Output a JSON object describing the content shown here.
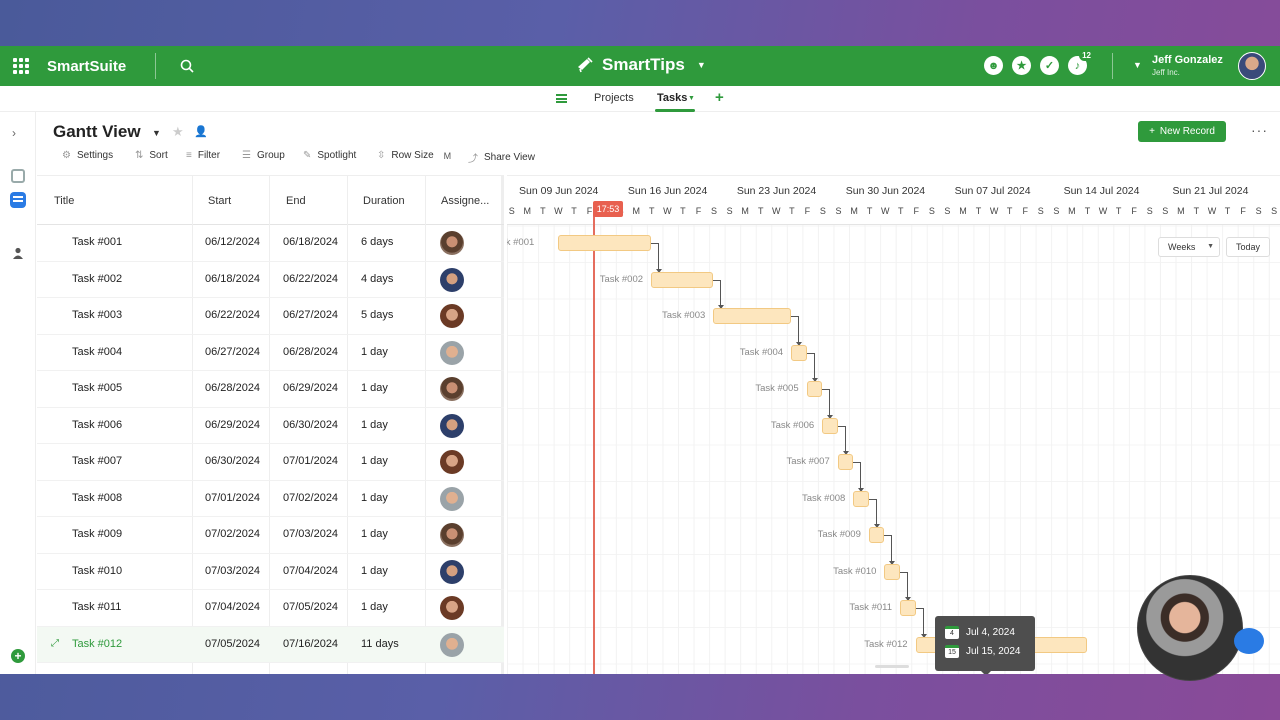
{
  "topbar": {
    "brand": "SmartSuite",
    "workspace": "SmartTips",
    "notification_count": "12",
    "user_name": "Jeff Gonzalez",
    "user_org": "Jeff Inc."
  },
  "nav": {
    "projects": "Projects",
    "tasks": "Tasks"
  },
  "view": {
    "title": "Gantt View",
    "new_record": "New Record",
    "toolbar": {
      "settings": "Settings",
      "sort": "Sort",
      "filter": "Filter",
      "group": "Group",
      "spotlight": "Spotlight",
      "row_size": "Row Size",
      "row_size_value": "M",
      "share_view": "Share View"
    }
  },
  "table": {
    "headers": {
      "title": "Title",
      "start": "Start",
      "end": "End",
      "duration": "Duration",
      "assignee": "Assigne..."
    },
    "rows": [
      {
        "title": "Task #001",
        "start": "06/12/2024",
        "end": "06/18/2024",
        "duration": "6 days"
      },
      {
        "title": "Task #002",
        "start": "06/18/2024",
        "end": "06/22/2024",
        "duration": "4 days"
      },
      {
        "title": "Task #003",
        "start": "06/22/2024",
        "end": "06/27/2024",
        "duration": "5 days"
      },
      {
        "title": "Task #004",
        "start": "06/27/2024",
        "end": "06/28/2024",
        "duration": "1 day"
      },
      {
        "title": "Task #005",
        "start": "06/28/2024",
        "end": "06/29/2024",
        "duration": "1 day"
      },
      {
        "title": "Task #006",
        "start": "06/29/2024",
        "end": "06/30/2024",
        "duration": "1 day"
      },
      {
        "title": "Task #007",
        "start": "06/30/2024",
        "end": "07/01/2024",
        "duration": "1 day"
      },
      {
        "title": "Task #008",
        "start": "07/01/2024",
        "end": "07/02/2024",
        "duration": "1 day"
      },
      {
        "title": "Task #009",
        "start": "07/02/2024",
        "end": "07/03/2024",
        "duration": "1 day"
      },
      {
        "title": "Task #010",
        "start": "07/03/2024",
        "end": "07/04/2024",
        "duration": "1 day"
      },
      {
        "title": "Task #011",
        "start": "07/04/2024",
        "end": "07/05/2024",
        "duration": "1 day"
      },
      {
        "title": "Task #012",
        "start": "07/05/2024",
        "end": "07/16/2024",
        "duration": "11 days"
      }
    ]
  },
  "gantt": {
    "weeks": [
      "Sun 09 Jun 2024",
      "Sun 16 Jun 2024",
      "Sun 23 Jun 2024",
      "Sun 30 Jun 2024",
      "Sun 07 Jul 2024",
      "Sun 14 Jul 2024",
      "Sun 21 Jul 2024"
    ],
    "day_letters": [
      "S",
      "M",
      "T",
      "W",
      "T",
      "F",
      "S"
    ],
    "today_time": "17:53",
    "today_date": "2024-06-14",
    "zoom": "Weeks",
    "today_button": "Today",
    "tooltip": {
      "start_day": "4",
      "start": "Jul 4, 2024",
      "end_day": "15",
      "end": "Jul 15, 2024"
    },
    "partial_first_label": "sk #001"
  },
  "colors": {
    "brand_green": "#2f9a3c",
    "bar_fill": "#fde6be",
    "today_red": "#e8604f"
  }
}
